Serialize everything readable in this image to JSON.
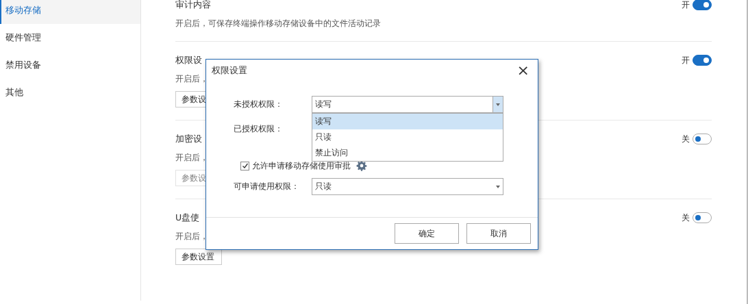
{
  "sidebar": {
    "items": [
      {
        "label": "移动存储",
        "selected": true
      },
      {
        "label": "硬件管理",
        "selected": false
      },
      {
        "label": "禁用设备",
        "selected": false
      },
      {
        "label": "其他",
        "selected": false
      }
    ]
  },
  "sections": [
    {
      "title": "审计内容",
      "toggle_label": "开",
      "on": true,
      "description": "开启后，可保存终端操作移动存储设备中的文件活动记录"
    },
    {
      "title": "权限设",
      "toggle_label": "开",
      "on": true,
      "description": "开启后，",
      "button": "参数设",
      "button_disabled": false
    },
    {
      "title": "加密设",
      "toggle_label": "关",
      "on": false,
      "description": "开启后，",
      "button": "参数设",
      "button_disabled": true
    },
    {
      "title": "U盘使",
      "toggle_label": "关",
      "on": false,
      "description": "开启后，",
      "button": "参数设置",
      "button_disabled": false
    }
  ],
  "dialog": {
    "title": "权限设置",
    "close": "×",
    "unauthorized": {
      "label": "未授权权限：",
      "value": "读写",
      "expanded": true,
      "options": [
        {
          "label": "读写",
          "selected": true
        },
        {
          "label": "只读",
          "selected": false
        },
        {
          "label": "禁止访问",
          "selected": false
        }
      ]
    },
    "authorized": {
      "label": "已授权权限："
    },
    "allow_request": {
      "label": "允许申请移动存储使用审批",
      "checked": true
    },
    "requestable": {
      "label": "可申请使用权限：",
      "value": "只读"
    },
    "buttons": [
      "确定",
      "取消"
    ]
  }
}
